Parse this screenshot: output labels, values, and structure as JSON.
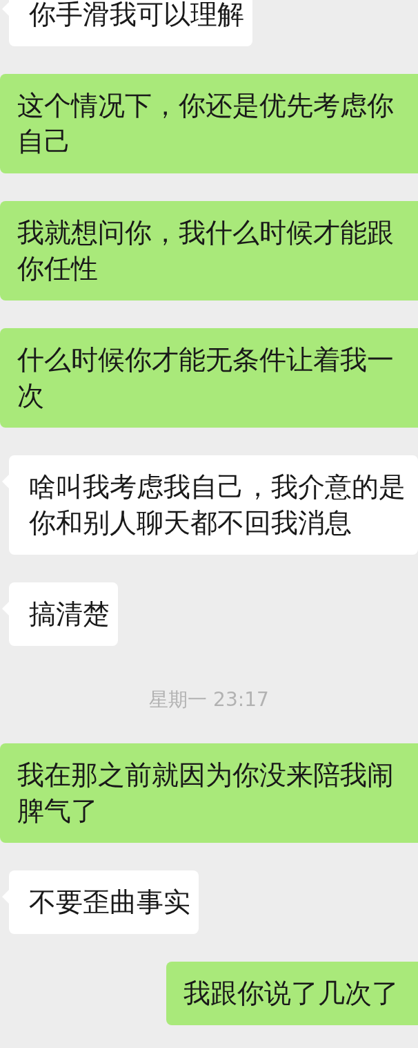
{
  "messages": [
    {
      "kind": "received",
      "text": "你手滑我可以理解"
    },
    {
      "kind": "sent",
      "text": "这个情况下，你还是优先考虑你自己"
    },
    {
      "kind": "sent",
      "text": "我就想问你，我什么时候才能跟你任性"
    },
    {
      "kind": "sent",
      "text": "什么时候你才能无条件让着我一次"
    },
    {
      "kind": "received",
      "text": "啥叫我考虑我自己，我介意的是你和别人聊天都不回我消息"
    },
    {
      "kind": "received",
      "text": "搞清楚"
    },
    {
      "kind": "time",
      "text": "星期一 23:17"
    },
    {
      "kind": "sent",
      "text": "我在那之前就因为你没来陪我闹脾气了"
    },
    {
      "kind": "received",
      "text": "不要歪曲事实"
    },
    {
      "kind": "sent",
      "text": "我跟你说了几次了"
    }
  ]
}
